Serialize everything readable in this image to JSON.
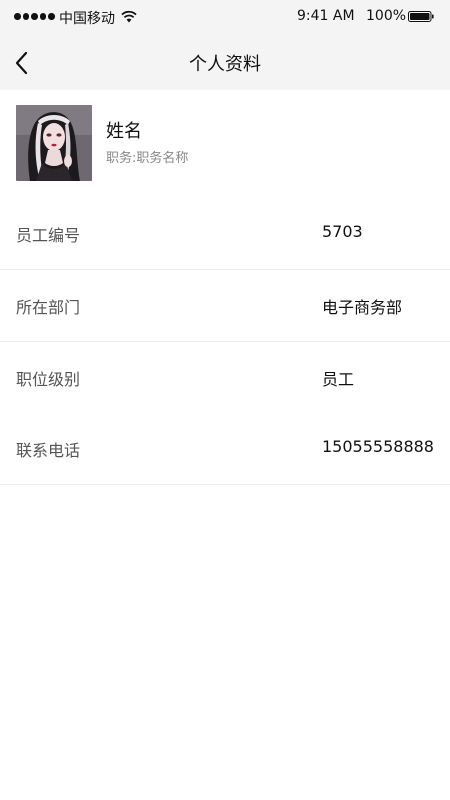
{
  "status_bar": {
    "carrier": "中国移动",
    "time": "9:41 AM",
    "battery": "100%",
    "icons": [
      "signal-icon",
      "wifi-icon",
      "battery-icon"
    ]
  },
  "nav": {
    "title": "个人资料",
    "back_icon": "chevron-left-icon"
  },
  "profile": {
    "name": "姓名",
    "role": "职务:职务名称"
  },
  "rows": [
    {
      "label": "员工编号",
      "value": "5703"
    },
    {
      "label": "所在部门",
      "value": "电子商务部"
    },
    {
      "label": "职位级别",
      "value": "员工"
    },
    {
      "label": "联系电话",
      "value": "15055558888"
    }
  ]
}
